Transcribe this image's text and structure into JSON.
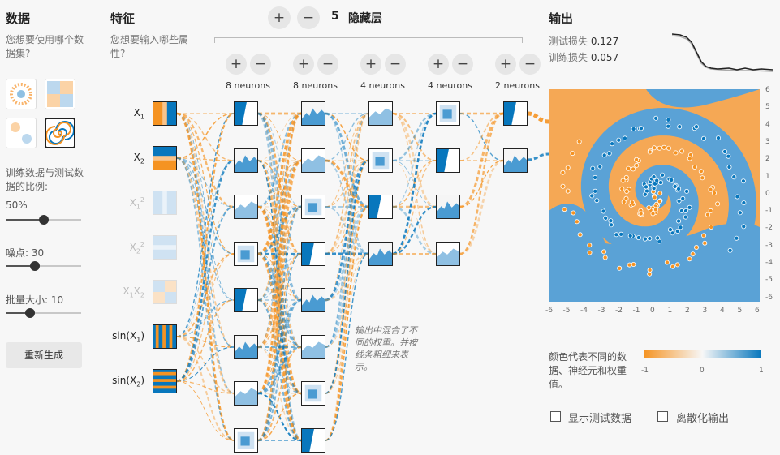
{
  "data_section": {
    "title": "数据",
    "question": "您想要使用哪个数据集?",
    "datasets": [
      {
        "name": "circle",
        "selected": false
      },
      {
        "name": "xor",
        "selected": false
      },
      {
        "name": "gaussian",
        "selected": false
      },
      {
        "name": "spiral",
        "selected": true
      }
    ],
    "ratio_label": "训练数据与测试数据的比例:",
    "ratio_value": "50%",
    "ratio_level": 0.5,
    "noise_label": "噪点:",
    "noise_value": "30",
    "noise_level": 0.3,
    "batch_label": "批量大小:",
    "batch_value": "10",
    "batch_level": 0.1,
    "regenerate": "重新生成"
  },
  "features": {
    "title": "特征",
    "question": "您想要输入哪些属性?",
    "items": [
      {
        "label": "X",
        "sub": "1",
        "sup": "",
        "active": true
      },
      {
        "label": "X",
        "sub": "2",
        "sup": "",
        "active": true
      },
      {
        "label": "X",
        "sub": "1",
        "sup": "2",
        "active": false
      },
      {
        "label": "X",
        "sub": "2",
        "sup": "2",
        "active": false
      },
      {
        "label": "X",
        "sub": "1",
        "mid": "X",
        "sub2": "2",
        "active": false
      },
      {
        "label": "sin(X",
        "sub": "1",
        "tail": ")",
        "active": true
      },
      {
        "label": "sin(X",
        "sub": "2",
        "tail": ")",
        "active": true
      }
    ]
  },
  "network": {
    "add_layer": "+",
    "remove_layer": "−",
    "layer_count": "5",
    "hidden_label": "隐藏层",
    "layers": [
      {
        "neurons": 8,
        "label": "8 neurons"
      },
      {
        "neurons": 8,
        "label": "8 neurons"
      },
      {
        "neurons": 4,
        "label": "4 neurons"
      },
      {
        "neurons": 4,
        "label": "4 neurons"
      },
      {
        "neurons": 2,
        "label": "2 neurons"
      }
    ],
    "plus": "+",
    "minus": "−",
    "note_lines": [
      "输出中混合了不",
      "同的权重。并按",
      "线条粗细来表",
      "示。"
    ]
  },
  "output": {
    "title": "输出",
    "test_loss_label": "测试损失",
    "test_loss": "0.127",
    "train_loss_label": "训练损失",
    "train_loss": "0.057",
    "axis_ticks": [
      "-6",
      "-5",
      "-4",
      "-3",
      "-2",
      "-1",
      "0",
      "1",
      "2",
      "3",
      "4",
      "5",
      "6"
    ],
    "yaxis_ticks": [
      "6",
      "5",
      "4",
      "3",
      "2",
      "1",
      "0",
      "-1",
      "-2",
      "-3",
      "-4",
      "-5",
      "-6"
    ],
    "legend_text": [
      "颜色代表不同的数",
      "据、神经元和权重",
      "值。"
    ],
    "legend_ticks": [
      "-1",
      "0",
      "1"
    ],
    "show_test_label": "显示测试数据",
    "discretize_label": "离散化输出"
  },
  "colors": {
    "orange": "#f59322",
    "blue": "#0877bd",
    "light_orange": "#f9b46b",
    "light_blue": "#5aa2d6"
  }
}
